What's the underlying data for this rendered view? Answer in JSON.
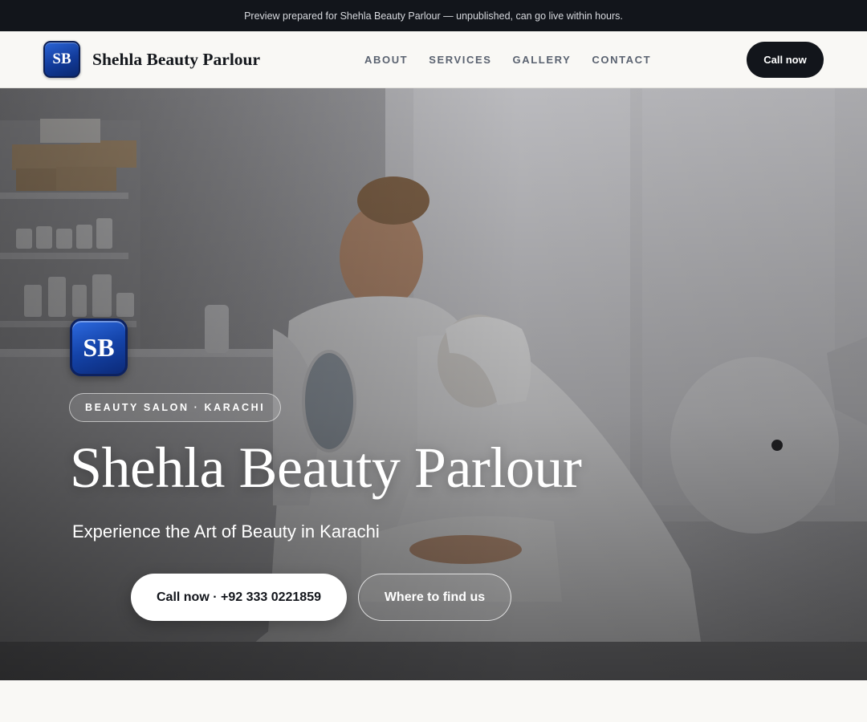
{
  "announcement": {
    "text": "Preview prepared for Shehla Beauty Parlour — unpublished, can go live within hours."
  },
  "header": {
    "logo_initials": "SB",
    "brand_name": "Shehla Beauty Parlour",
    "nav": [
      {
        "label": "ABOUT"
      },
      {
        "label": "SERVICES"
      },
      {
        "label": "GALLERY"
      },
      {
        "label": "CONTACT"
      }
    ],
    "cta_label": "Call now"
  },
  "hero": {
    "logo_initials": "SB",
    "tag": "BEAUTY SALON · KARACHI",
    "title": "Shehla Beauty Parlour",
    "subtitle": "Experience the Art of Beauty in Karachi",
    "primary_button": "Call now · +92 333 0221859",
    "secondary_button": "Where to find us"
  },
  "colors": {
    "dark": "#12151b",
    "logo_blue": "#1443a8",
    "page_bg": "#f9f8f5"
  }
}
